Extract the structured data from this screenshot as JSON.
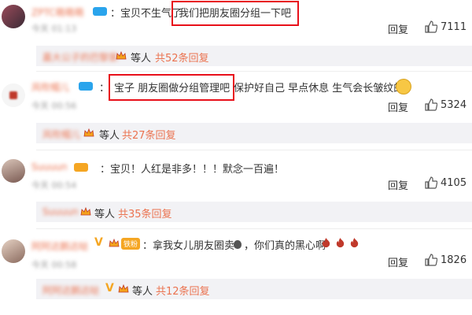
{
  "comments": [
    {
      "user": "ZPTC萌萌萌",
      "time": "今天 01:13",
      "text": "：宝贝不生气了",
      "highlighted": "我们把朋友圈分组一下吧",
      "reply_label": "回复",
      "likes": "7111",
      "replies": {
        "user": "嘉大公子的巴黎家",
        "etc": "等人",
        "count": "共52条回复"
      }
    },
    {
      "user": "风吹帽儿",
      "time": "今天 00:56",
      "text_prefix": "：",
      "highlighted": "宝子 朋友圈做分组管理吧",
      "text_suffix": "保护好自己 早点休息 生气会长皱纹的",
      "reply_label": "回复",
      "likes": "5324",
      "replies": {
        "user": "风吹帽儿",
        "etc": "等人",
        "count": "共27条回复"
      }
    },
    {
      "user": "Suuuun",
      "time": "今天 00:54",
      "text": "：宝贝！人红是非多！！！默念一百遍！",
      "reply_label": "回复",
      "likes": "4105",
      "replies": {
        "user": "Suuuun",
        "etc": "等人",
        "count": "共35条回复"
      }
    },
    {
      "user": "阿阿达鹅达哒",
      "badge": "铁粉",
      "time": "今天 00:58",
      "text": "：拿我女儿朋友圈卖",
      "text_suffix": "，你们真的黑心啊",
      "reply_label": "回复",
      "likes": "1826",
      "replies": {
        "user": "阿阿达鹅达哒",
        "etc": "等人",
        "count": "共12条回复"
      }
    }
  ],
  "colors": {
    "accent": "#eb7350",
    "highlight_box": "#e8101a",
    "reply_bg": "#f2f2f5"
  },
  "icons": [
    "thumb-up-icon",
    "vip-badge-icon",
    "crown-icon",
    "fire-emoji-icon",
    "smile-emoji-icon",
    "money-bag-icon"
  ]
}
